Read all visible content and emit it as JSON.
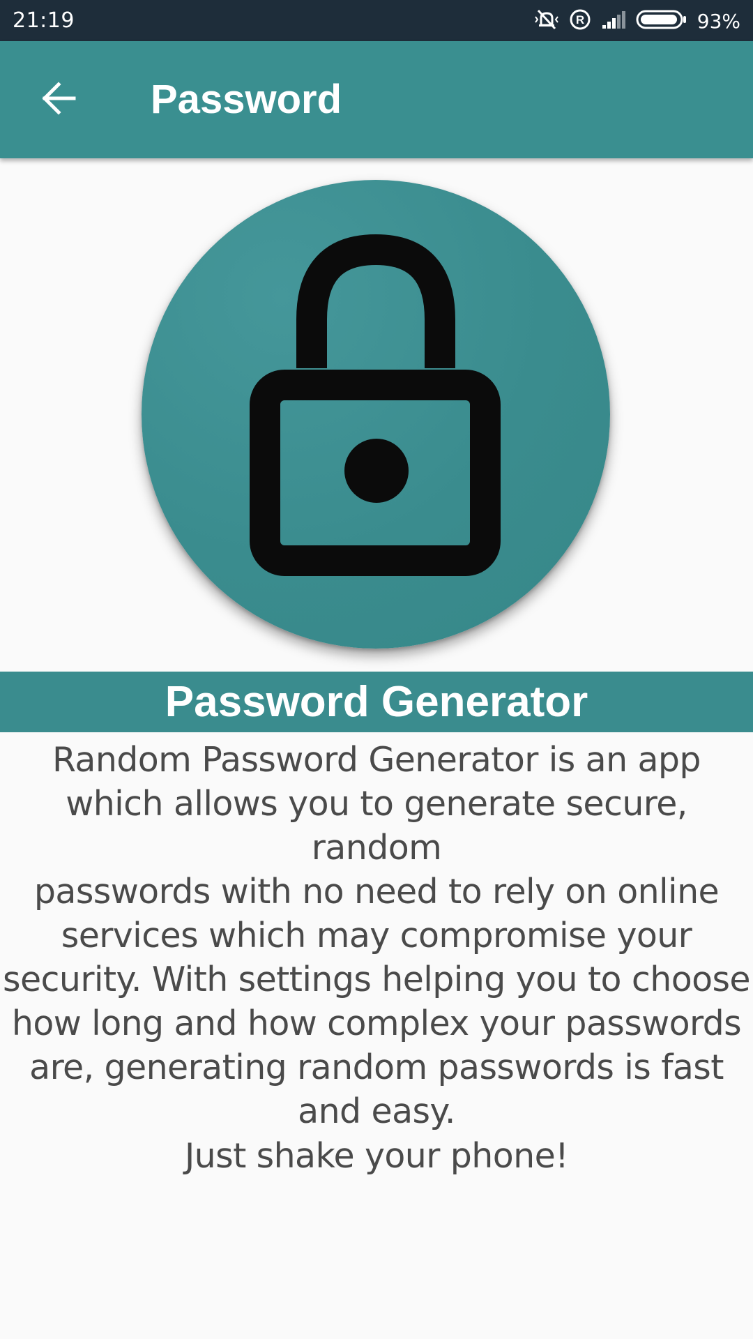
{
  "status_bar": {
    "time": "21:19",
    "battery_percent": "93%",
    "icons": [
      "mute-vibrate-icon",
      "registered-icon",
      "signal-icon",
      "battery-icon"
    ]
  },
  "app_bar": {
    "title": "Password",
    "back_icon": "arrow-back-icon"
  },
  "hero": {
    "icon": "lock-icon"
  },
  "banner": {
    "title": "Password Generator"
  },
  "content": {
    "description_lines": [
      "Random Password Generator is an app",
      "which allows you to generate secure, random",
      "passwords with no need to rely on online",
      "services which may compromise your",
      "security. With settings helping you to choose",
      "how long and how complex your passwords",
      "are, generating random passwords is fast",
      "and easy."
    ],
    "tagline": "Just shake your phone!"
  },
  "colors": {
    "primary": "#3a8f90",
    "status_bar": "#1e2d3a",
    "background": "#fafafa",
    "text": "#4a4a4a"
  }
}
